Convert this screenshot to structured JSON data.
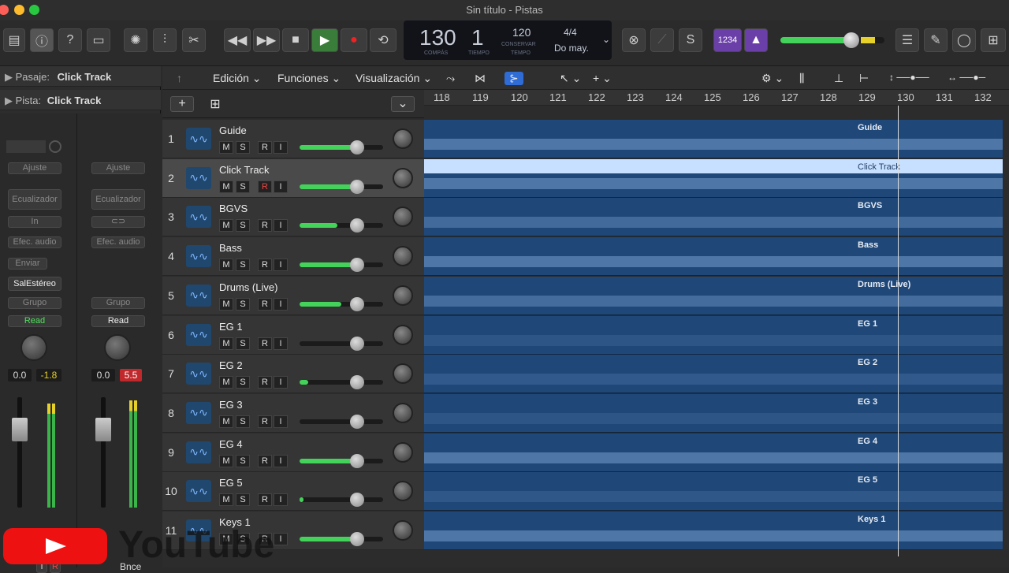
{
  "window": {
    "title": "Sin título - Pistas"
  },
  "transport": {
    "bar": "130",
    "beat": "1",
    "bar_label": "COMPÁS",
    "beat_label": "TIEMPO",
    "tempo": "120",
    "tempo_sub": "CONSERVAR",
    "tempo_label": "TEMPO",
    "signature": "4/4",
    "key": "Do may."
  },
  "lcd_mode": "1234",
  "inspector": {
    "region_label": "Pasaje:",
    "region_value": "Click Track",
    "track_label": "Pista:",
    "track_value": "Click Track"
  },
  "strip1": {
    "ajuste": "Ajuste",
    "eq": "Ecualizador",
    "in": "In",
    "efec": "Efec. audio",
    "enviar": "Enviar",
    "output": "SalEstéreo",
    "grupo": "Grupo",
    "read": "Read",
    "pan": "0.0",
    "gain": "-1.8"
  },
  "strip2": {
    "ajuste": "Ajuste",
    "eq": "Ecualizador",
    "efec": "Efec. audio",
    "grupo": "Grupo",
    "read": "Read",
    "pan": "0.0",
    "gain": "5.5",
    "bnce": "Bnce"
  },
  "menubar": {
    "edit": "Edición",
    "functions": "Funciones",
    "view": "Visualización"
  },
  "ruler": [
    "118",
    "119",
    "120",
    "121",
    "122",
    "123",
    "124",
    "125",
    "126",
    "127",
    "128",
    "129",
    "130",
    "131",
    "132"
  ],
  "tracks": [
    {
      "num": "1",
      "name": "Guide",
      "vol": 0.7
    },
    {
      "num": "2",
      "name": "Click Track",
      "vol": 0.7
    },
    {
      "num": "3",
      "name": "BGVS",
      "vol": 0.45
    },
    {
      "num": "4",
      "name": "Bass",
      "vol": 0.7
    },
    {
      "num": "5",
      "name": "Drums (Live)",
      "vol": 0.5
    },
    {
      "num": "6",
      "name": "EG 1",
      "vol": 0.0
    },
    {
      "num": "7",
      "name": "EG 2",
      "vol": 0.1
    },
    {
      "num": "8",
      "name": "EG 3",
      "vol": 0.0
    },
    {
      "num": "9",
      "name": "EG 4",
      "vol": 0.7
    },
    {
      "num": "10",
      "name": "EG 5",
      "vol": 0.05
    },
    {
      "num": "11",
      "name": "Keys 1",
      "vol": 0.7
    }
  ],
  "msri": {
    "m": "M",
    "s": "S",
    "r": "R",
    "i": "I"
  },
  "watermark": "YouTube",
  "colors": {
    "accent_green": "#44d35a",
    "region_blue": "#1f4778",
    "selected_region": "#c8e0ff"
  }
}
